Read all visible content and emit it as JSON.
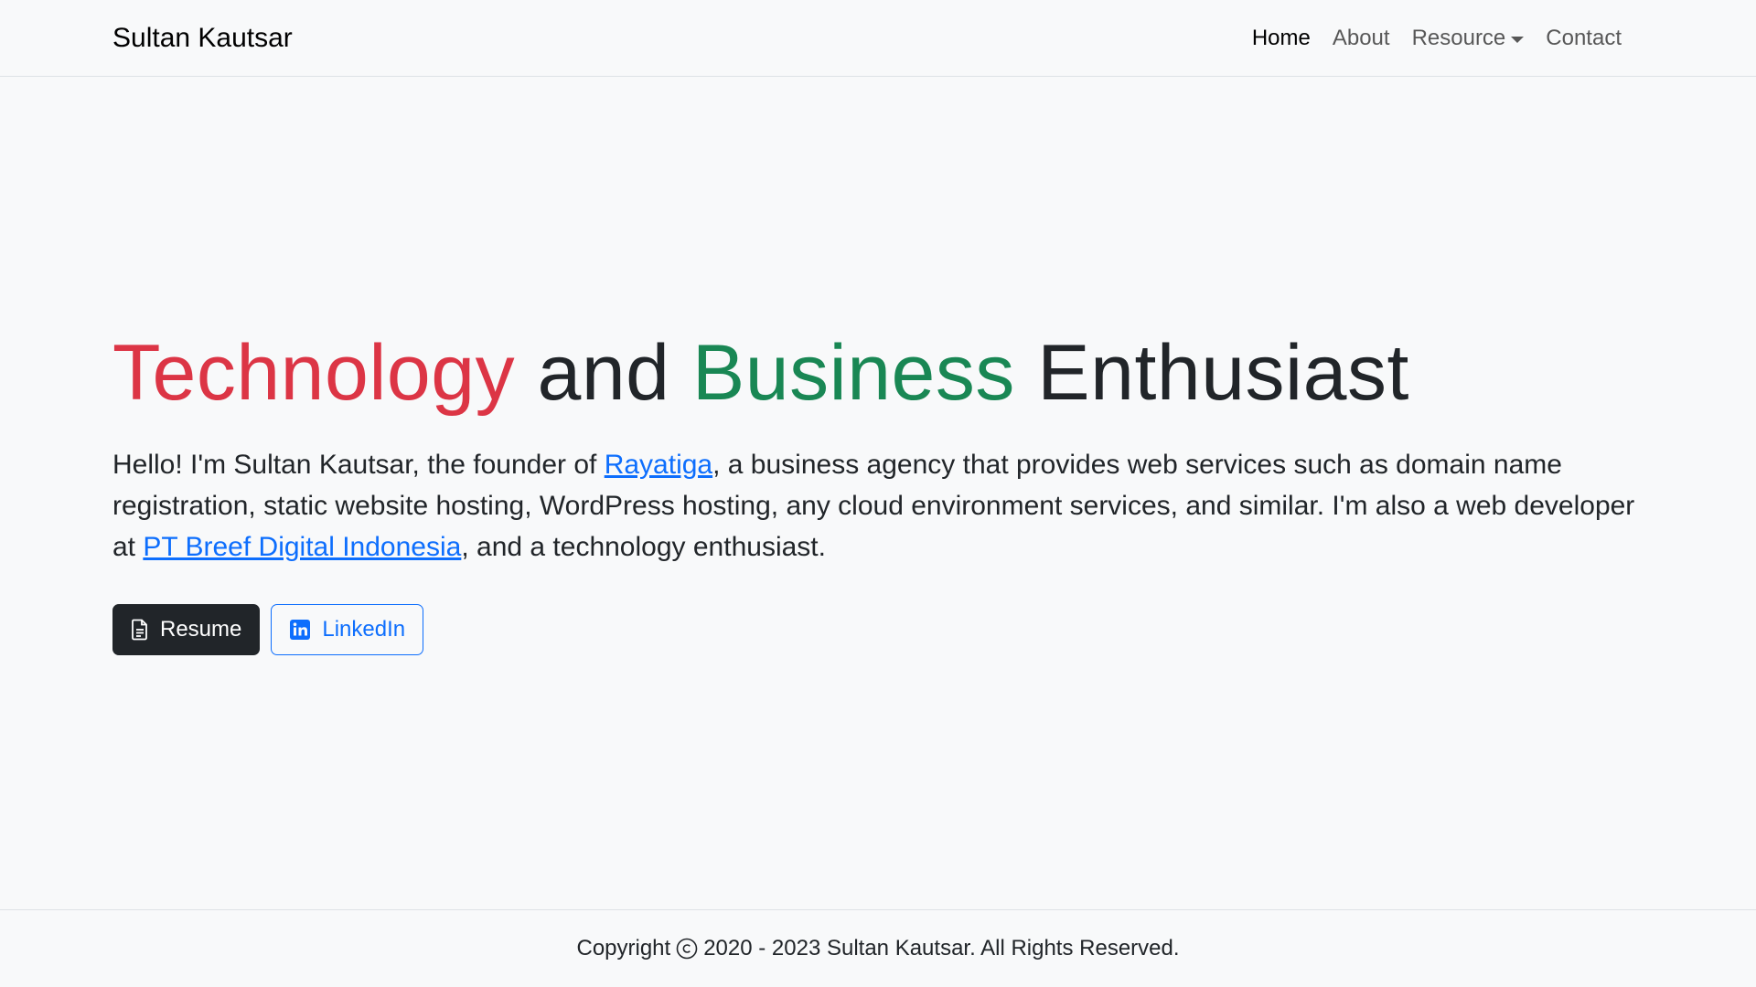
{
  "navbar": {
    "brand": "Sultan Kautsar",
    "items": [
      {
        "label": "Home",
        "active": true
      },
      {
        "label": "About",
        "active": false
      },
      {
        "label": "Resource",
        "active": false,
        "dropdown": true
      },
      {
        "label": "Contact",
        "active": false
      }
    ]
  },
  "hero": {
    "headline": {
      "word1": "Technology",
      "word2": "and",
      "word3": "Business",
      "word4": "Enthusiast"
    },
    "intro": {
      "part1": "Hello! I'm Sultan Kautsar, the founder of ",
      "link1": "Rayatiga",
      "part2": ", a business agency that provides web services such as domain name registration, static website hosting, WordPress hosting, any cloud environment services, and similar. I'm also a web developer at ",
      "link2": "PT Breef Digital Indonesia",
      "part3": ", and a technology enthusiast."
    },
    "buttons": {
      "resume": "Resume",
      "linkedin": "LinkedIn"
    }
  },
  "footer": {
    "before_symbol": "Copyright",
    "after_symbol": "2020 - 2023 Sultan Kautsar. All Rights Reserved."
  },
  "colors": {
    "accent_red": "#dc3545",
    "accent_green": "#198754",
    "link_blue": "#0d6efd",
    "dark": "#212529",
    "background": "#f8f9fa"
  },
  "icons": {
    "resume": "file-text-icon",
    "linkedin": "linkedin-icon",
    "copyright": "copyright-icon",
    "dropdown": "caret-down-icon"
  }
}
